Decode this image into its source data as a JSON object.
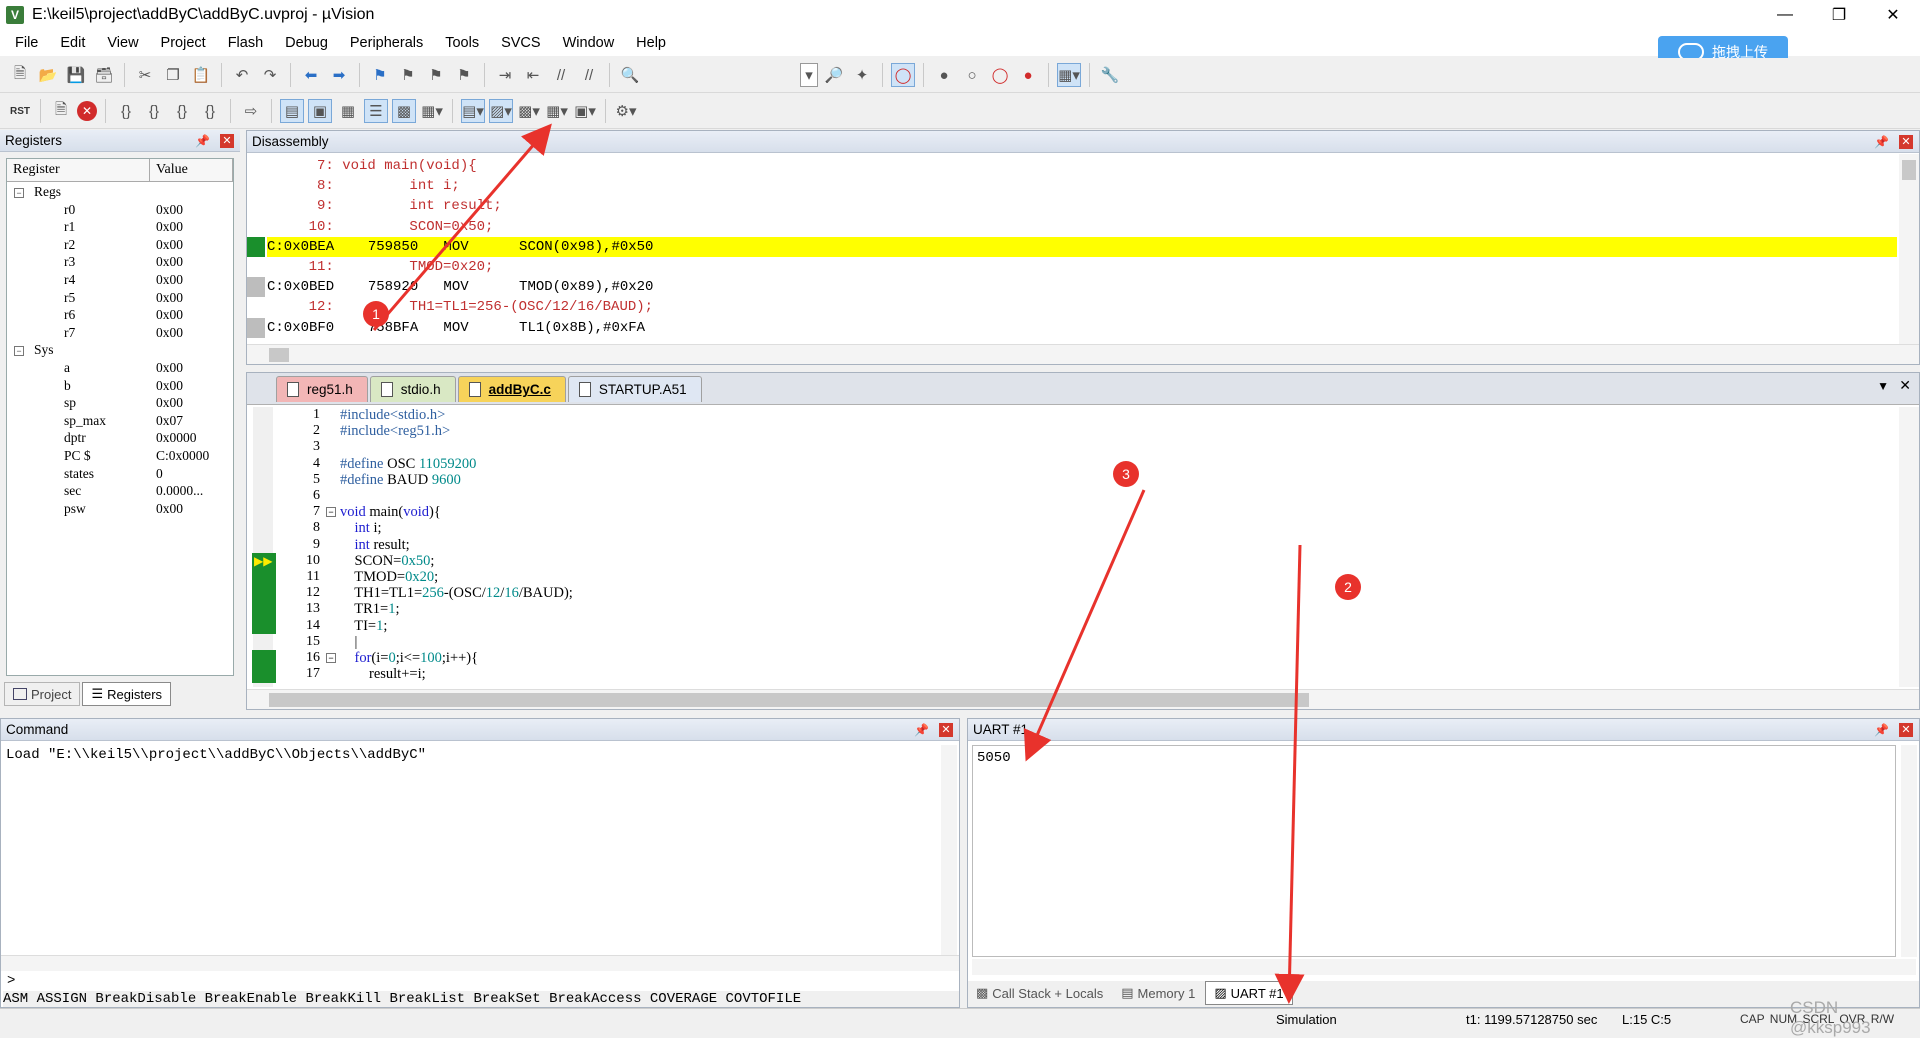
{
  "window": {
    "title": "E:\\keil5\\project\\addByC\\addByC.uvproj - µVision",
    "app_icon": "V"
  },
  "menu": [
    "File",
    "Edit",
    "View",
    "Project",
    "Flash",
    "Debug",
    "Peripherals",
    "Tools",
    "SVCS",
    "Window",
    "Help"
  ],
  "upload_button": "拖拽上传",
  "registers_panel": {
    "title": "Registers",
    "col_register": "Register",
    "col_value": "Value",
    "groups": [
      {
        "name": "Regs",
        "items": [
          {
            "name": "r0",
            "value": "0x00"
          },
          {
            "name": "r1",
            "value": "0x00"
          },
          {
            "name": "r2",
            "value": "0x00"
          },
          {
            "name": "r3",
            "value": "0x00"
          },
          {
            "name": "r4",
            "value": "0x00"
          },
          {
            "name": "r5",
            "value": "0x00"
          },
          {
            "name": "r6",
            "value": "0x00"
          },
          {
            "name": "r7",
            "value": "0x00"
          }
        ]
      },
      {
        "name": "Sys",
        "items": [
          {
            "name": "a",
            "value": "0x00"
          },
          {
            "name": "b",
            "value": "0x00"
          },
          {
            "name": "sp",
            "value": "0x00"
          },
          {
            "name": "sp_max",
            "value": "0x07"
          },
          {
            "name": "dptr",
            "value": "0x0000"
          },
          {
            "name": "PC  $",
            "value": "C:0x0000"
          },
          {
            "name": "states",
            "value": "0"
          },
          {
            "name": "sec",
            "value": "0.0000..."
          },
          {
            "name": "psw",
            "value": "0x00"
          }
        ]
      }
    ],
    "tab_project": "Project",
    "tab_registers": "Registers"
  },
  "disassembly": {
    "title": "Disassembly",
    "lines": [
      {
        "type": "src",
        "text": "     7: void main(void){"
      },
      {
        "type": "src",
        "text": "     8:         int i;"
      },
      {
        "type": "src",
        "text": "     9:         int result;"
      },
      {
        "type": "src",
        "text": "    10:         SCON=0x50;"
      },
      {
        "type": "asm",
        "text": "C:0x0BEA    759850   MOV      SCON(0x98),#0x50",
        "current": true
      },
      {
        "type": "src",
        "text": "    11:         TMOD=0x20;"
      },
      {
        "type": "asm",
        "text": "C:0x0BED    758920   MOV      TMOD(0x89),#0x20"
      },
      {
        "type": "src",
        "text": "    12:         TH1=TL1=256-(OSC/12/16/BAUD);"
      },
      {
        "type": "asm",
        "text": "C:0x0BF0    758BFA   MOV      TL1(0x8B),#0xFA"
      }
    ]
  },
  "editor": {
    "tabs": [
      {
        "label": "reg51.h",
        "color": "#f2b6b6"
      },
      {
        "label": "stdio.h",
        "color": "#d9e8c4"
      },
      {
        "label": "addByC.c",
        "color": "#f7d35a",
        "active": true
      },
      {
        "label": "STARTUP.A51",
        "color": "#dfe7f3"
      }
    ],
    "lines": [
      {
        "n": "1",
        "html": "<span class='pp'>#include&lt;stdio.h&gt;</span>"
      },
      {
        "n": "2",
        "html": "<span class='pp'>#include&lt;reg51.h&gt;</span>"
      },
      {
        "n": "3",
        "html": ""
      },
      {
        "n": "4",
        "html": "<span class='pp'>#define</span> OSC <span class='num'>11059200</span>"
      },
      {
        "n": "5",
        "html": "<span class='pp'>#define</span> BAUD <span class='num'>9600</span>"
      },
      {
        "n": "6",
        "html": ""
      },
      {
        "n": "7",
        "html": "<span class='kw'>void</span> main(<span class='kw'>void</span>){"
      },
      {
        "n": "8",
        "html": "    <span class='kw'>int</span> i;"
      },
      {
        "n": "9",
        "html": "    <span class='kw'>int</span> result;"
      },
      {
        "n": "10",
        "html": "    SCON=<span class='num'>0x50</span>;"
      },
      {
        "n": "11",
        "html": "    TMOD=<span class='num'>0x20</span>;"
      },
      {
        "n": "12",
        "html": "    TH1=TL1=<span class='num'>256</span>-(OSC/<span class='num'>12</span>/<span class='num'>16</span>/BAUD);"
      },
      {
        "n": "13",
        "html": "    TR1=<span class='num'>1</span>;"
      },
      {
        "n": "14",
        "html": "    TI=<span class='num'>1</span>;"
      },
      {
        "n": "15",
        "html": "    |"
      },
      {
        "n": "16",
        "html": "    <span class='kw'>for</span>(i=<span class='num'>0</span>;i&lt;=<span class='num'>100</span>;i++){"
      },
      {
        "n": "17",
        "html": "        result+=i;"
      }
    ]
  },
  "command": {
    "title": "Command",
    "output": "Load \"E:\\\\keil5\\\\project\\\\addByC\\\\Objects\\\\addByC\"",
    "prompt": ">",
    "hints": "ASM ASSIGN BreakDisable BreakEnable BreakKill BreakList BreakSet BreakAccess COVERAGE COVTOFILE"
  },
  "uart": {
    "title": "UART #1",
    "output": "5050",
    "tabs": [
      "Call Stack + Locals",
      "Memory 1",
      "UART #1"
    ]
  },
  "status": {
    "mode": "Simulation",
    "time": "t1: 1199.57128750 sec",
    "pos": "L:15 C:5",
    "flags": "CAP  NUM  SCRL  OVR  R/W"
  },
  "annotations": [
    "1",
    "2",
    "3"
  ],
  "watermark": "CSDN @kksp993"
}
